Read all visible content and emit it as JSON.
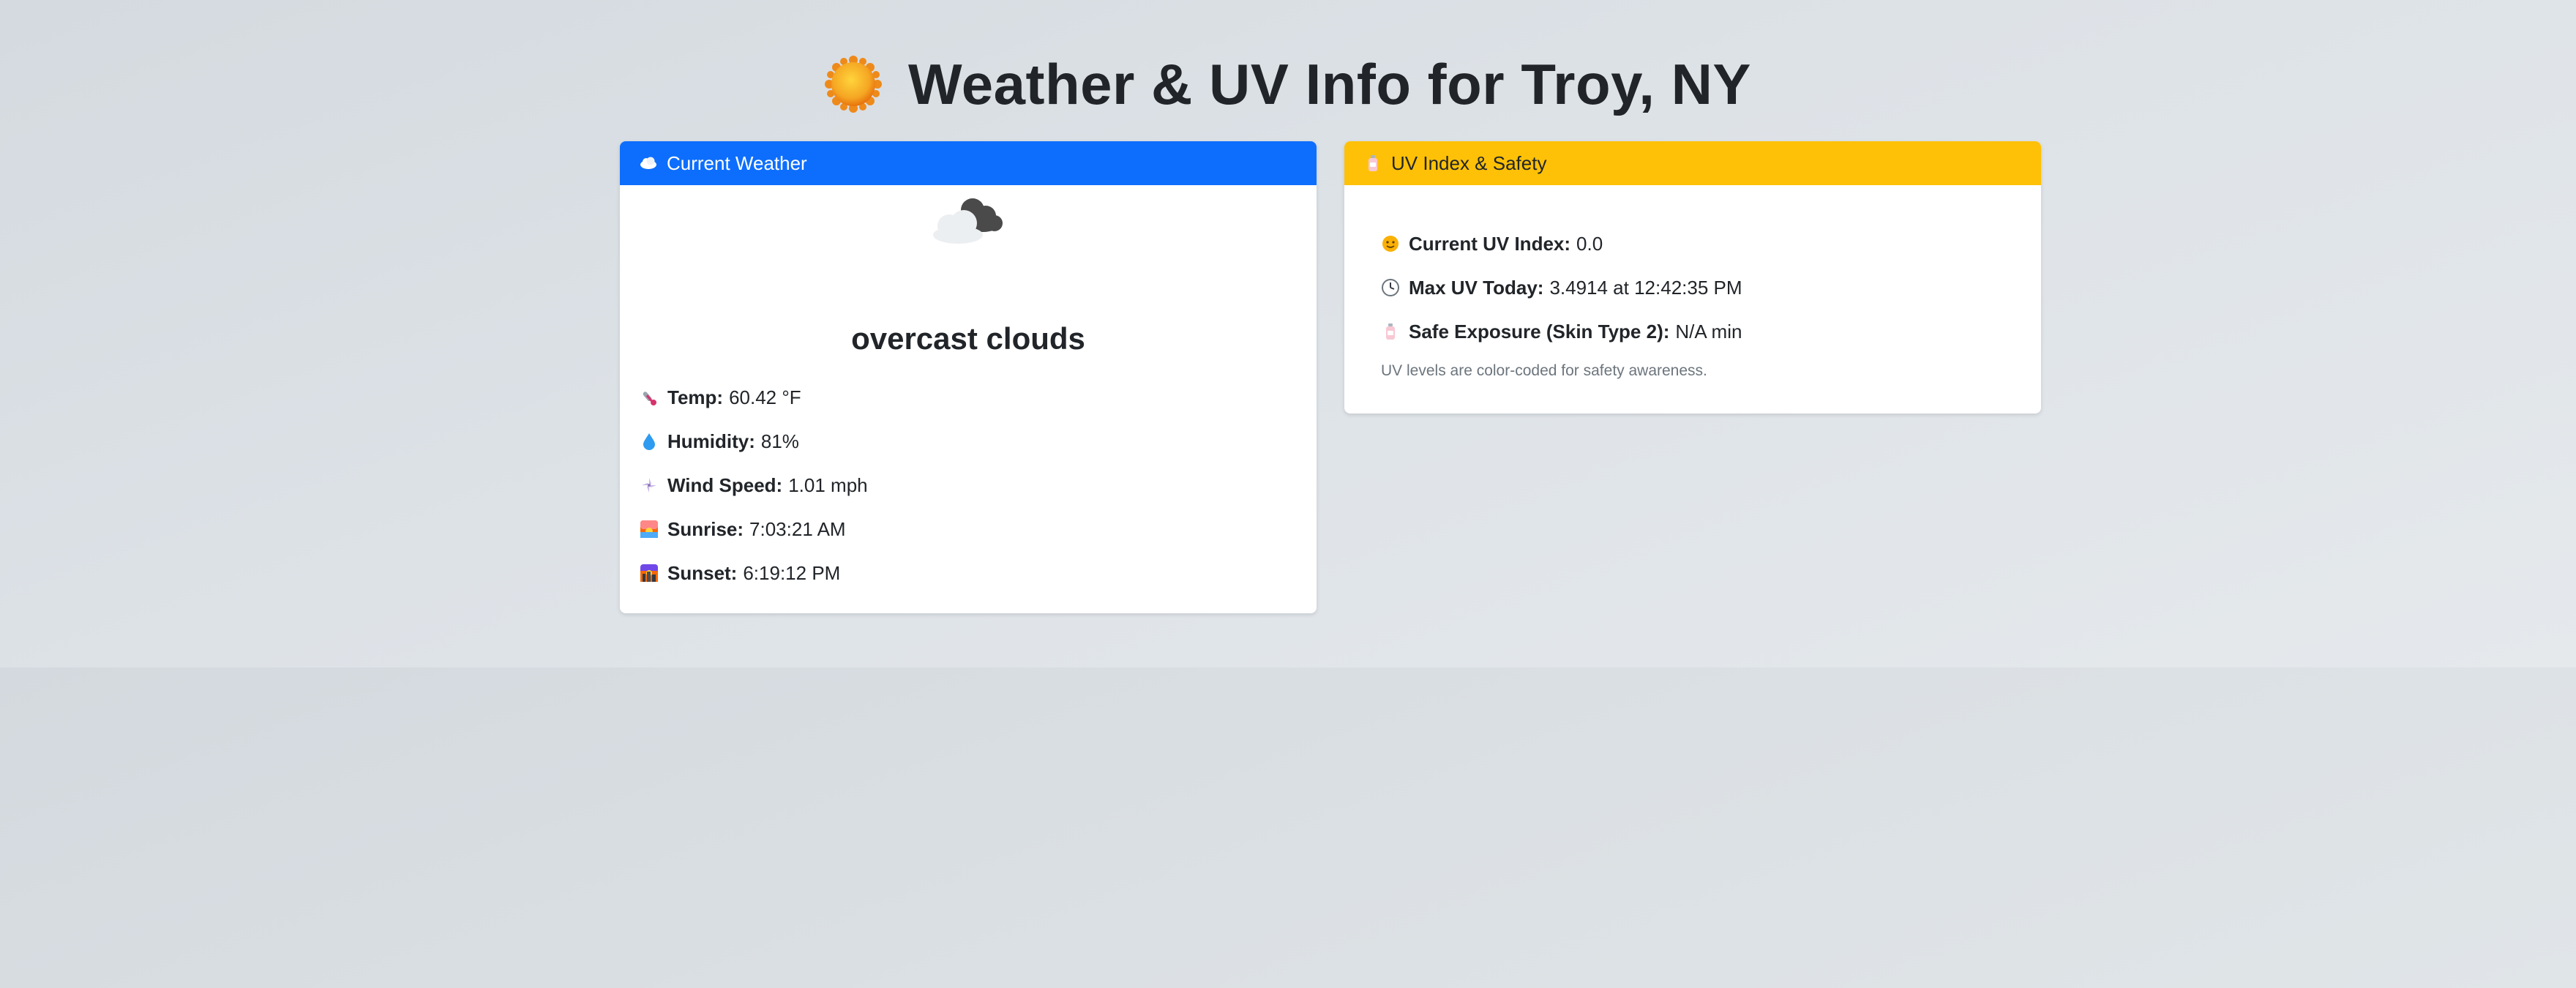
{
  "page": {
    "title": "Weather & UV Info for Troy, NY",
    "title_icon": "sun-icon"
  },
  "weather_card": {
    "header": "Current Weather",
    "header_icon": "cloud-icon",
    "header_color": "#0d6efd",
    "condition_icon": "overcast-clouds-icon",
    "description": "overcast clouds",
    "rows": [
      {
        "icon": "thermometer-icon",
        "label": "Temp:",
        "value": "60.42 °F"
      },
      {
        "icon": "droplet-icon",
        "label": "Humidity:",
        "value": "81%"
      },
      {
        "icon": "wind-icon",
        "label": "Wind Speed:",
        "value": "1.01 mph"
      },
      {
        "icon": "sunrise-icon",
        "label": "Sunrise:",
        "value": "7:03:21 AM"
      },
      {
        "icon": "sunset-icon",
        "label": "Sunset:",
        "value": "6:19:12 PM"
      }
    ]
  },
  "uv_card": {
    "header": "UV Index & Safety",
    "header_icon": "lotion-bottle-icon",
    "header_color": "#ffc107",
    "rows": [
      {
        "icon": "sun-face-icon",
        "label": "Current UV Index:",
        "value": "0.0"
      },
      {
        "icon": "clock-icon",
        "label": "Max UV Today:",
        "value": "3.4914 at 12:42:35 PM"
      },
      {
        "icon": "lotion-bottle-icon",
        "label": "Safe Exposure (Skin Type 2):",
        "value": "N/A min"
      }
    ],
    "note": "UV levels are color-coded for safety awareness."
  }
}
